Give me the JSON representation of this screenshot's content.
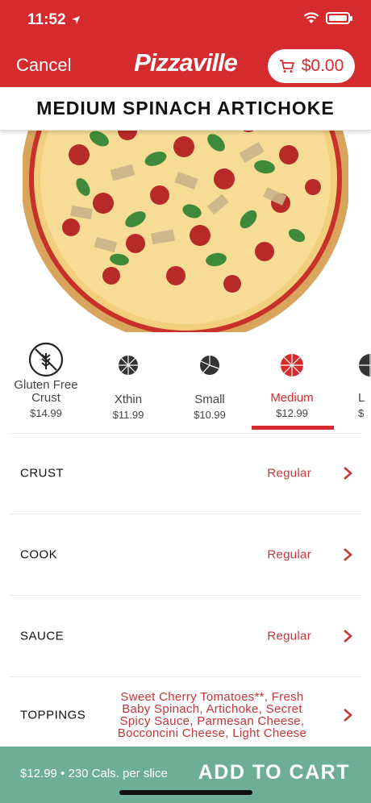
{
  "status": {
    "time": "11:52"
  },
  "header": {
    "cancel_label": "Cancel",
    "brand": "Pizzaville",
    "cart_total": "$0.00"
  },
  "product": {
    "title": "MEDIUM SPINACH ARTICHOKE"
  },
  "sizes": [
    {
      "name": "Gluten Free Crust",
      "price": "$14.99",
      "icon": "wheat-icon"
    },
    {
      "name": "Xthin",
      "price": "$11.99",
      "icon": "pizza-slices-icon"
    },
    {
      "name": "Small",
      "price": "$10.99",
      "icon": "pizza-slices-icon"
    },
    {
      "name": "Medium",
      "price": "$12.99",
      "icon": "pizza-slices-icon",
      "selected": true
    },
    {
      "name": "L",
      "price": "$",
      "icon": "pizza-slices-icon"
    }
  ],
  "options": [
    {
      "label": "CRUST",
      "value": "Regular"
    },
    {
      "label": "COOK",
      "value": "Regular"
    },
    {
      "label": "SAUCE",
      "value": "Regular"
    },
    {
      "label": "TOPPINGS",
      "value": "Sweet Cherry Tomatoes**, Fresh Baby Spinach, Artichoke, Secret Spicy Sauce, Parmesan Cheese, Bocconcini Cheese, Light Cheese"
    }
  ],
  "footer": {
    "info": "$12.99 • 230 Cals. per slice",
    "add_label": "ADD TO CART"
  },
  "colors": {
    "brand_red": "#d52b2e",
    "footer_green": "#6fae96"
  }
}
